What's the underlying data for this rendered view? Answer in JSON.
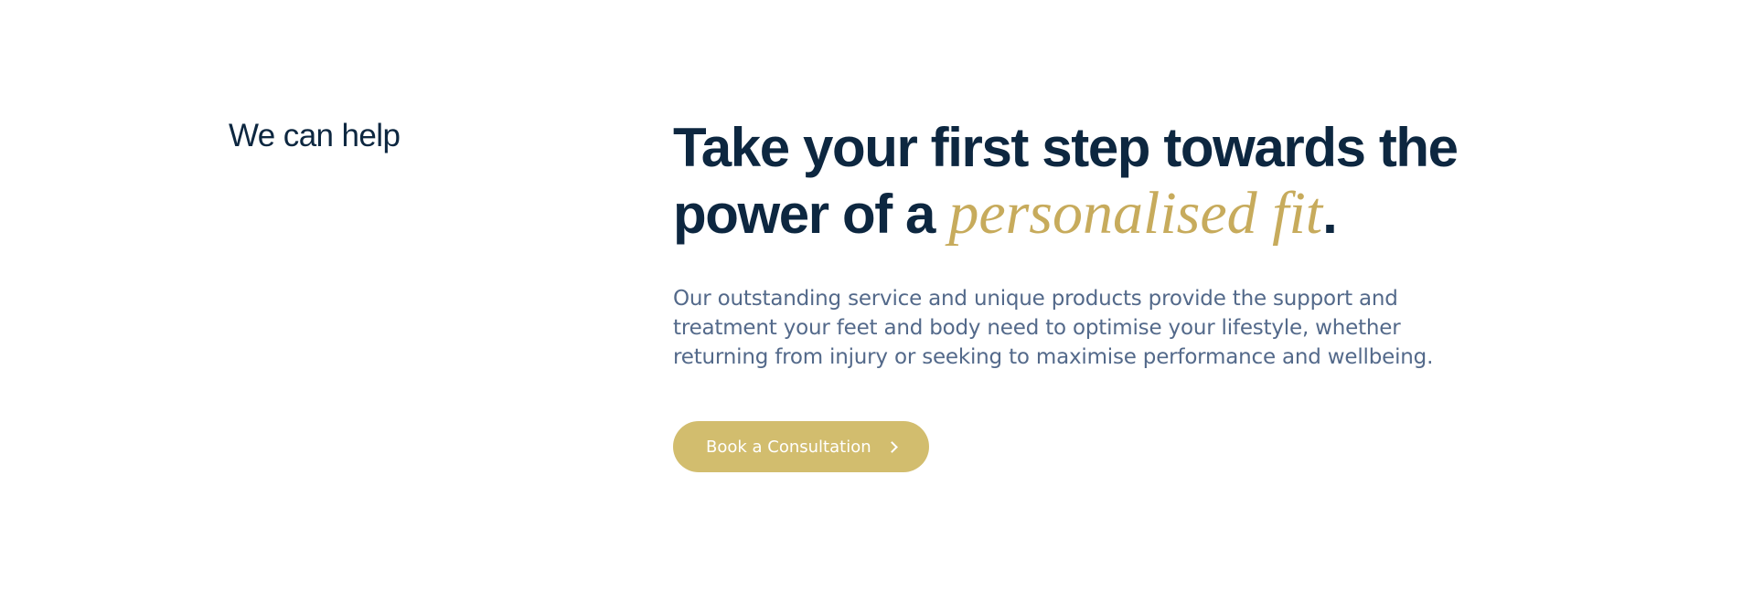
{
  "section": {
    "eyebrow": "We can help",
    "heading": {
      "line1": "Take your first step towards the",
      "line2_prefix": "power of a ",
      "accent": "personalised fit",
      "suffix": "."
    },
    "lead": "Our outstanding service and unique products provide the support and treatment your feet and body need to optimise your lifestyle, whether returning from injury or seeking to maximise performance and wellbeing.",
    "cta": {
      "label": "Book a Consultation",
      "icon": "chevron-right-icon"
    }
  },
  "colors": {
    "heading": "#0d2740",
    "accent": "#c7ab5c",
    "body_text": "#53698a",
    "button_bg": "#d2bd6e",
    "button_text": "#ffffff",
    "background": "#ffffff"
  }
}
